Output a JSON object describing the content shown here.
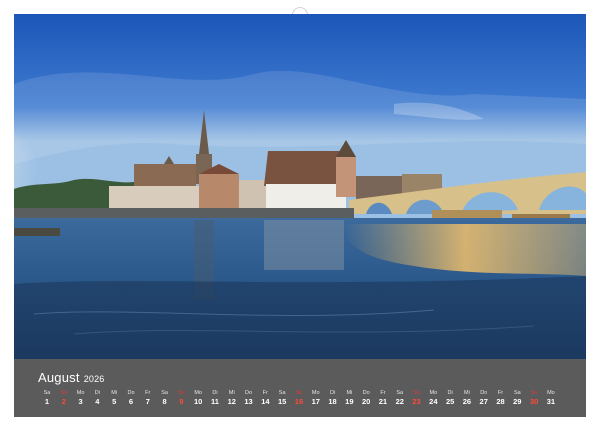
{
  "calendar": {
    "month": "August",
    "year": "2026",
    "days": [
      {
        "wd": "Sa",
        "d": "1",
        "sun": false
      },
      {
        "wd": "So",
        "d": "2",
        "sun": true
      },
      {
        "wd": "Mo",
        "d": "3",
        "sun": false
      },
      {
        "wd": "Di",
        "d": "4",
        "sun": false
      },
      {
        "wd": "Mi",
        "d": "5",
        "sun": false
      },
      {
        "wd": "Do",
        "d": "6",
        "sun": false
      },
      {
        "wd": "Fr",
        "d": "7",
        "sun": false
      },
      {
        "wd": "Sa",
        "d": "8",
        "sun": false
      },
      {
        "wd": "So",
        "d": "9",
        "sun": true
      },
      {
        "wd": "Mo",
        "d": "10",
        "sun": false
      },
      {
        "wd": "Di",
        "d": "11",
        "sun": false
      },
      {
        "wd": "Mi",
        "d": "12",
        "sun": false
      },
      {
        "wd": "Do",
        "d": "13",
        "sun": false
      },
      {
        "wd": "Fr",
        "d": "14",
        "sun": false
      },
      {
        "wd": "Sa",
        "d": "15",
        "sun": false
      },
      {
        "wd": "So",
        "d": "16",
        "sun": true
      },
      {
        "wd": "Mo",
        "d": "17",
        "sun": false
      },
      {
        "wd": "Di",
        "d": "18",
        "sun": false
      },
      {
        "wd": "Mi",
        "d": "19",
        "sun": false
      },
      {
        "wd": "Do",
        "d": "20",
        "sun": false
      },
      {
        "wd": "Fr",
        "d": "21",
        "sun": false
      },
      {
        "wd": "Sa",
        "d": "22",
        "sun": false
      },
      {
        "wd": "So",
        "d": "23",
        "sun": true
      },
      {
        "wd": "Mo",
        "d": "24",
        "sun": false
      },
      {
        "wd": "Di",
        "d": "25",
        "sun": false
      },
      {
        "wd": "Mi",
        "d": "26",
        "sun": false
      },
      {
        "wd": "Do",
        "d": "27",
        "sun": false
      },
      {
        "wd": "Fr",
        "d": "28",
        "sun": false
      },
      {
        "wd": "Sa",
        "d": "29",
        "sun": false
      },
      {
        "wd": "So",
        "d": "30",
        "sun": true
      },
      {
        "wd": "Mo",
        "d": "31",
        "sun": false
      }
    ]
  },
  "colors": {
    "calendar_bar": "#5b5b5b",
    "sunday_accent": "#e03a3a",
    "sky": "#2a5ea8",
    "bridge_stone": "#d8c08a"
  },
  "icons": {
    "binding": "wire-binding-icon"
  }
}
